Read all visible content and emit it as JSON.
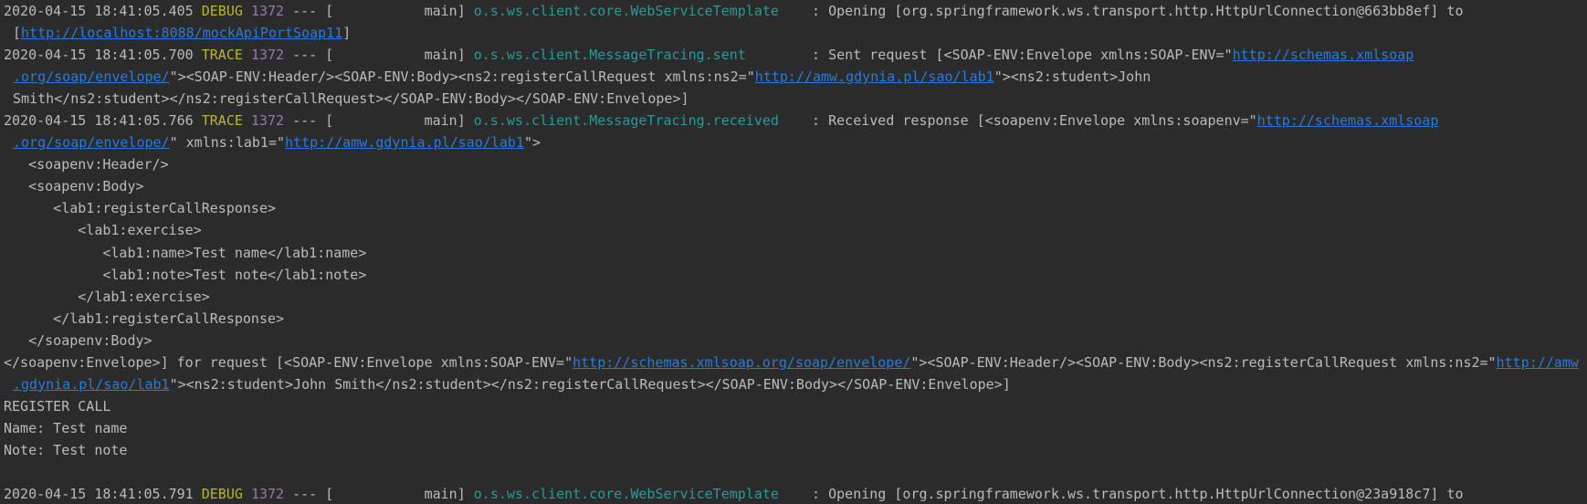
{
  "lines": [
    {
      "ts": "2020-04-15 18:41:05.405",
      "level": "DEBUG",
      "pid": "1372",
      "sep": " --- [           main] ",
      "logger": "o.s.ws.client.core.WebServiceTemplate",
      "pad": "    ",
      "msg": ": Opening [org.springframework.ws.transport.http.HttpUrlConnection@663bb8ef] to"
    },
    {
      "pre": "[",
      "link": "http://localhost:8088/mockApiPortSoap11",
      "post": "]"
    },
    {
      "ts": "2020-04-15 18:41:05.700",
      "level": "TRACE",
      "pid": "1372",
      "sep": " --- [           main] ",
      "logger": "o.s.ws.client.MessageTracing.sent",
      "pad": "        ",
      "msg": ": Sent request [<SOAP-ENV:Envelope xmlns:SOAP-ENV=\"",
      "link": "http://schemas.xmlsoap"
    },
    {
      "link1": ".org/soap/envelope/",
      "mid": "\"><SOAP-ENV:Header/><SOAP-ENV:Body><ns2:registerCallRequest xmlns:ns2=\"",
      "link2": "http://amw.gdynia.pl/sao/lab1",
      "post": "\"><ns2:student>John"
    },
    {
      "text": "Smith</ns2:student></ns2:registerCallRequest></SOAP-ENV:Body></SOAP-ENV:Envelope>]"
    },
    {
      "ts": "2020-04-15 18:41:05.766",
      "level": "TRACE",
      "pid": "1372",
      "sep": " --- [           main] ",
      "logger": "o.s.ws.client.MessageTracing.received",
      "pad": "    ",
      "msg": ": Received response [<soapenv:Envelope xmlns:soapenv=\"",
      "link": "http://schemas.xmlsoap"
    },
    {
      "link1": ".org/soap/envelope/",
      "mid": "\" xmlns:lab1=\"",
      "link2": "http://amw.gdynia.pl/sao/lab1",
      "post": "\">"
    },
    {
      "text": "   <soapenv:Header/>"
    },
    {
      "text": "   <soapenv:Body>"
    },
    {
      "text": "      <lab1:registerCallResponse>"
    },
    {
      "text": "         <lab1:exercise>"
    },
    {
      "text": "            <lab1:name>Test name</lab1:name>"
    },
    {
      "text": "            <lab1:note>Test note</lab1:note>"
    },
    {
      "text": "         </lab1:exercise>"
    },
    {
      "text": "      </lab1:registerCallResponse>"
    },
    {
      "text": "   </soapenv:Body>"
    },
    {
      "pre": "</soapenv:Envelope>] for request [<SOAP-ENV:Envelope xmlns:SOAP-ENV=\"",
      "link1": "http://schemas.xmlsoap.org/soap/envelope/",
      "mid": "\"><SOAP-ENV:Header/><SOAP-ENV:Body><ns2:registerCallRequest xmlns:ns2=\"",
      "link2": "http://amw"
    },
    {
      "link": ".gdynia.pl/sao/lab1",
      "post": "\"><ns2:student>John Smith</ns2:student></ns2:registerCallRequest></SOAP-ENV:Body></SOAP-ENV:Envelope>]"
    },
    {
      "text": "REGISTER CALL"
    },
    {
      "text": "Name: Test name"
    },
    {
      "text": "Note: Test note"
    },
    {
      "text": ""
    },
    {
      "ts": "2020-04-15 18:41:05.791",
      "level": "DEBUG",
      "pid": "1372",
      "sep": " --- [           main] ",
      "logger": "o.s.ws.client.core.WebServiceTemplate",
      "pad": "    ",
      "msg": ": Opening [org.springframework.ws.transport.http.HttpUrlConnection@23a918c7] to"
    }
  ]
}
